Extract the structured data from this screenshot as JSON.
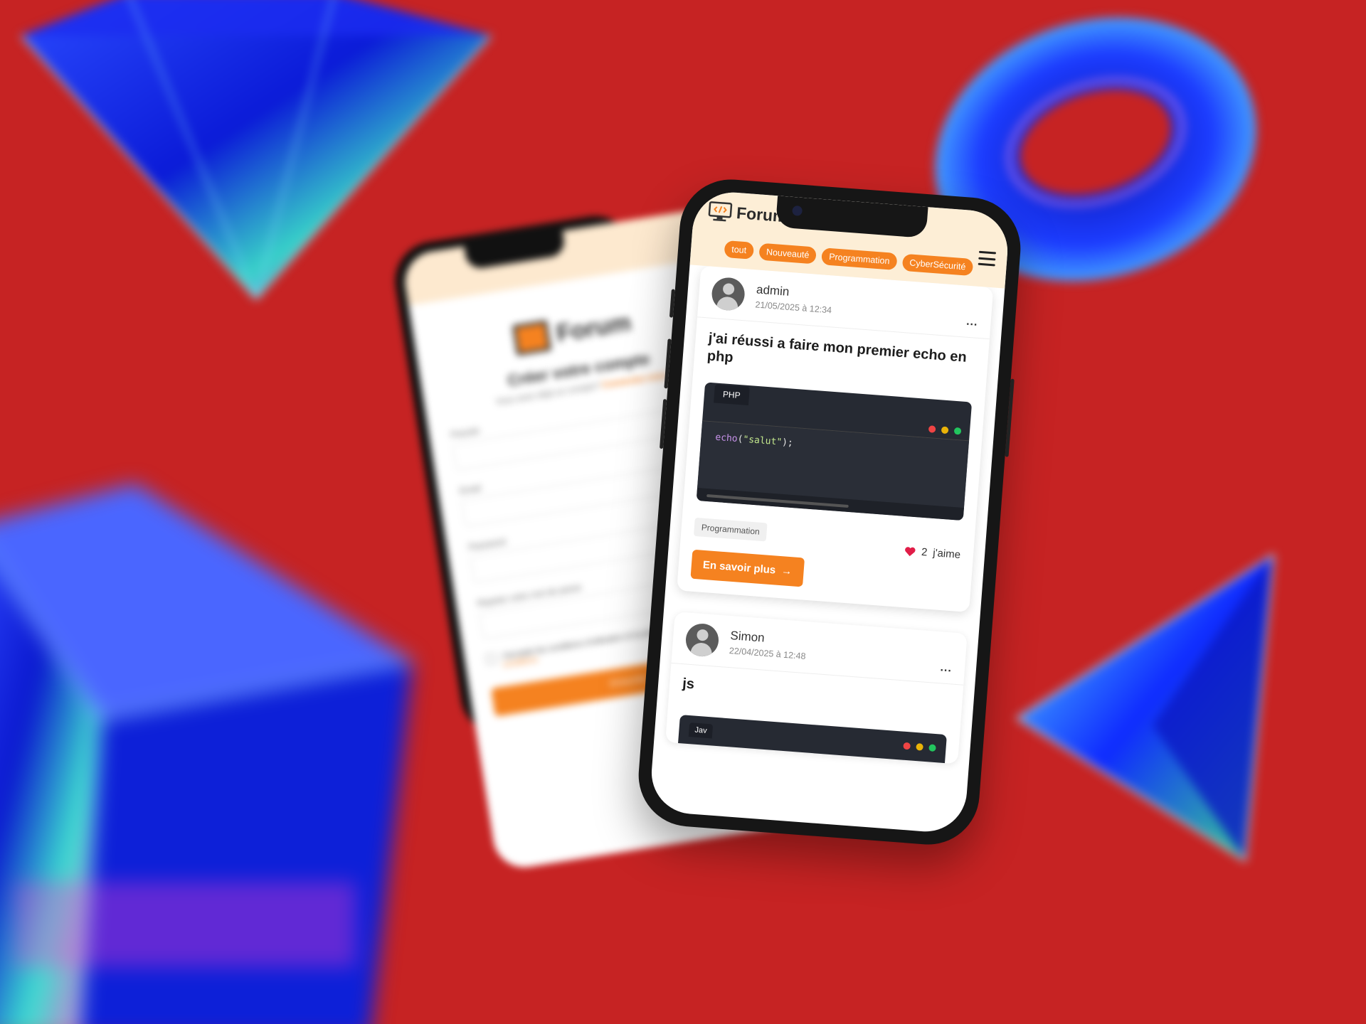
{
  "app": {
    "brand": "Forum",
    "filters": [
      "tout",
      "Nouveauté",
      "Programmation",
      "CyberSécurité"
    ]
  },
  "posts": [
    {
      "author": "admin",
      "date": "21/05/2025 à 12:34",
      "more": "...",
      "title": "j'ai réussi a faire mon premier echo en php",
      "code_lang": "PHP",
      "code_keyword": "echo",
      "code_open": "(",
      "code_string": "\"salut\"",
      "code_close": ");",
      "tag": "Programmation",
      "likes_count": "2",
      "likes_label": "j'aime",
      "cta": "En savoir plus",
      "cta_arrow": "→"
    },
    {
      "author": "Simon",
      "date": "22/04/2025 à 12:48",
      "more": "...",
      "title": "js",
      "code_lang": "Jav"
    }
  ],
  "back_phone": {
    "brand": "Forum",
    "title": "Créer votre compte",
    "subtitle_prefix": "Vous avez déjà un compte?",
    "subtitle_link": "Connectez-vous",
    "fields": [
      "Pseudo",
      "Email",
      "Password",
      "Repeter votre mot de passe"
    ],
    "check_text": "J'accepte les conditions d'utilisation et la politique de confidentialité",
    "check_link": "conditions",
    "button": "S'inscrire"
  },
  "colors": {
    "background": "#c62323",
    "accent": "#f58220",
    "header": "#fdeed6",
    "code_bg": "#262a33",
    "dot_red": "#ef4444",
    "dot_yellow": "#eab308",
    "dot_green": "#22c55e"
  }
}
